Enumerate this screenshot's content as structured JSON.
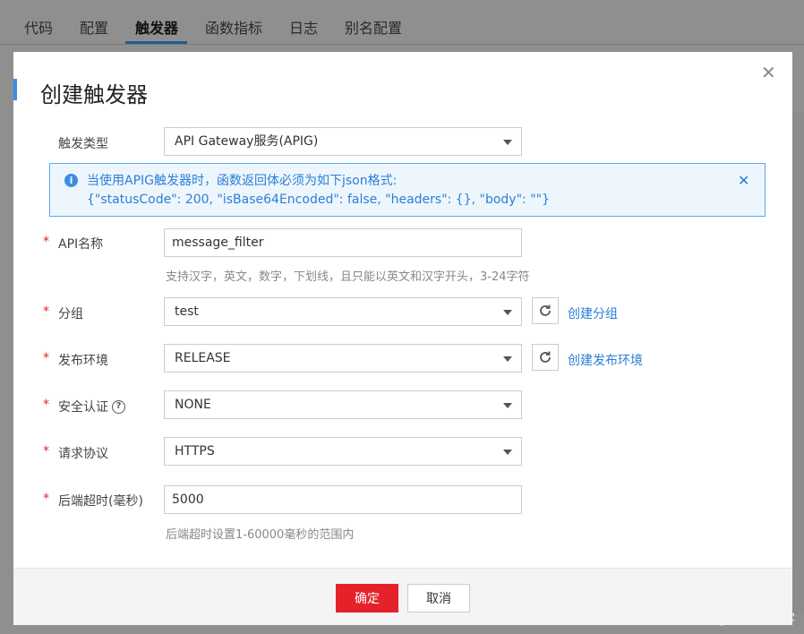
{
  "tabs": [
    {
      "label": "代码"
    },
    {
      "label": "配置"
    },
    {
      "label": "触发器",
      "active": true
    },
    {
      "label": "函数指标"
    },
    {
      "label": "日志"
    },
    {
      "label": "别名配置"
    }
  ],
  "modal": {
    "title": "创建触发器",
    "trigger_type": {
      "label": "触发类型",
      "value": "API Gateway服务(APIG)"
    },
    "notice": {
      "line1": "当使用APIG触发器时，函数返回体必须为如下json格式:",
      "line2": "{\"statusCode\": 200, \"isBase64Encoded\": false, \"headers\": {}, \"body\": \"\"}"
    },
    "required_mark": "*",
    "api_name": {
      "label": "API名称",
      "value": "message_filter",
      "hint": "支持汉字，英文，数字，下划线，且只能以英文和汉字开头，3-24字符"
    },
    "group": {
      "label": "分组",
      "value": "test",
      "link": "创建分组"
    },
    "env": {
      "label": "发布环境",
      "value": "RELEASE",
      "link": "创建发布环境"
    },
    "auth": {
      "label": "安全认证",
      "value": "NONE",
      "help": "?"
    },
    "protocol": {
      "label": "请求协议",
      "value": "HTTPS"
    },
    "timeout": {
      "label": "后端超时(毫秒)",
      "value": "5000",
      "hint": "后端超时设置1-60000毫秒的范围内"
    },
    "ok_label": "确定",
    "cancel_label": "取消"
  },
  "watermark": "@51CTO博客",
  "colors": {
    "accent": "#3a8ee6",
    "primary_button": "#e5222a",
    "link": "#2a7fd6"
  }
}
